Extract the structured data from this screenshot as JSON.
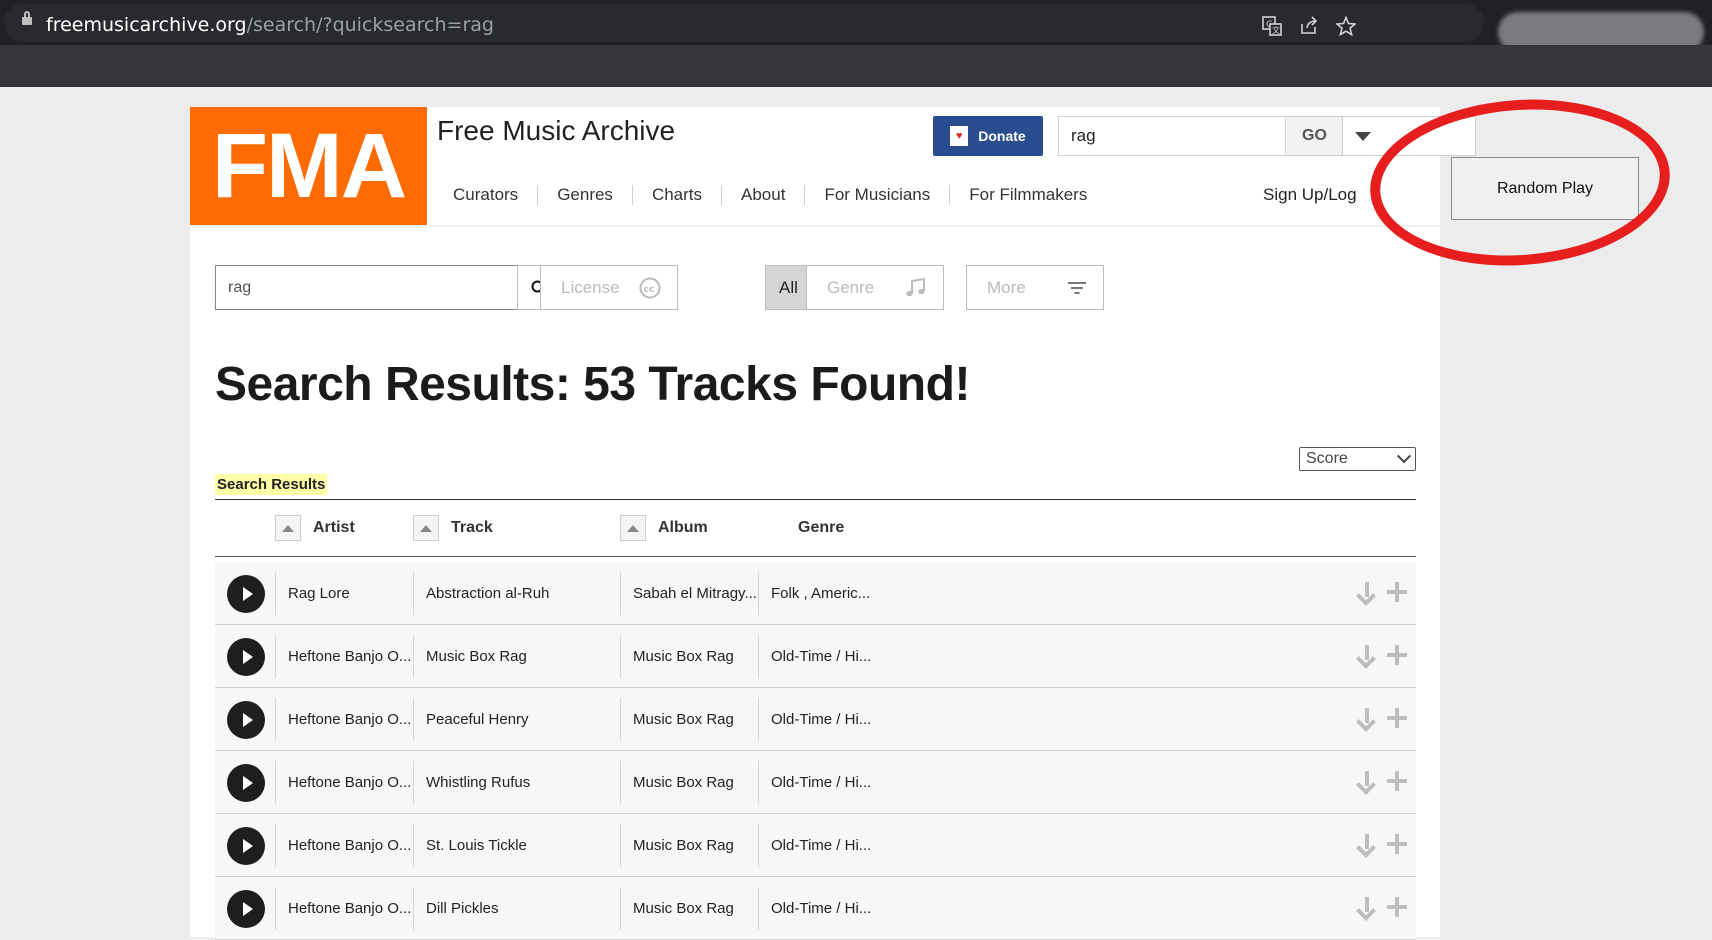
{
  "browser": {
    "url_host": "freemusicarchive.org",
    "url_path": "/search/?quicksearch=rag"
  },
  "header": {
    "logo_text": "FMA",
    "site_title": "Free Music Archive",
    "donate_label": "Donate",
    "search_value": "rag",
    "go_label": "GO",
    "signup_label": "Sign Up/Log",
    "nav": [
      "Curators",
      "Genres",
      "Charts",
      "About",
      "For Musicians",
      "For Filmmakers"
    ]
  },
  "random_play_label": "Random Play",
  "filters": {
    "search_value": "rag",
    "license_label": "License",
    "all_label": "All",
    "genre_label": "Genre",
    "more_label": "More"
  },
  "results": {
    "heading": "Search Results: 53 Tracks Found!",
    "sort_value": "Score",
    "section_label": "Search Results",
    "columns": {
      "artist": "Artist",
      "track": "Track",
      "album": "Album",
      "genre": "Genre"
    },
    "rows": [
      {
        "artist": "Rag Lore",
        "track": "Abstraction al-Ruh",
        "album": "Sabah el Mitragy...",
        "genre": "Folk , Americ..."
      },
      {
        "artist": "Heftone Banjo O...",
        "track": "Music Box Rag",
        "album": "Music Box Rag",
        "genre": "Old-Time / Hi..."
      },
      {
        "artist": "Heftone Banjo O...",
        "track": "Peaceful Henry",
        "album": "Music Box Rag",
        "genre": "Old-Time / Hi..."
      },
      {
        "artist": "Heftone Banjo O...",
        "track": "Whistling Rufus",
        "album": "Music Box Rag",
        "genre": "Old-Time / Hi..."
      },
      {
        "artist": "Heftone Banjo O...",
        "track": "St. Louis Tickle",
        "album": "Music Box Rag",
        "genre": "Old-Time / Hi..."
      },
      {
        "artist": "Heftone Banjo O...",
        "track": "Dill Pickles",
        "album": "Music Box Rag",
        "genre": "Old-Time / Hi..."
      }
    ]
  },
  "colors": {
    "accent": "#ff6b00",
    "donate": "#2a4d8f",
    "annotation": "#e61e1e",
    "highlight": "#ffffa8"
  }
}
